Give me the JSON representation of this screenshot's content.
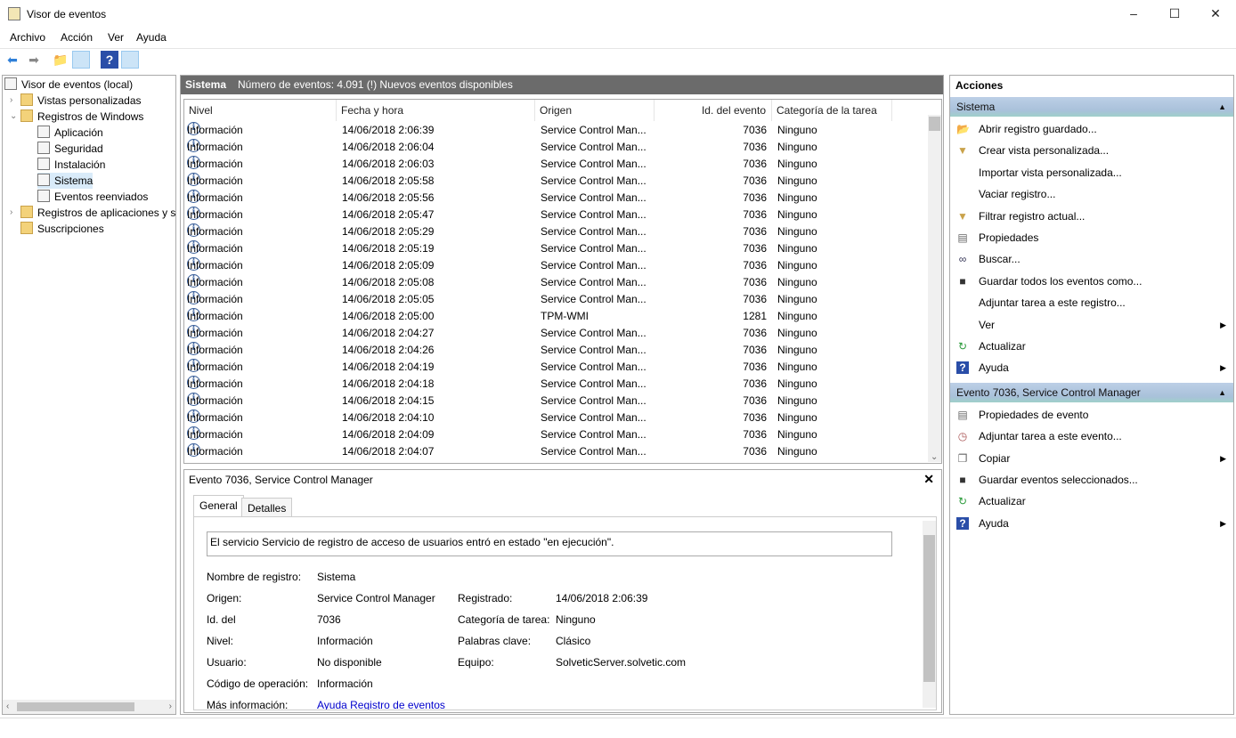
{
  "window": {
    "title": "Visor de eventos",
    "min": "–",
    "max": "☐",
    "close": "✕"
  },
  "menu": [
    "Archivo",
    "Acción",
    "Ver",
    "Ayuda"
  ],
  "tree": [
    {
      "label": "Visor de eventos (local)",
      "level": 0,
      "exp": ""
    },
    {
      "label": "Vistas personalizadas",
      "level": 1,
      "exp": "›"
    },
    {
      "label": "Registros de Windows",
      "level": 1,
      "exp": "⌄"
    },
    {
      "label": "Aplicación",
      "level": 2,
      "exp": ""
    },
    {
      "label": "Seguridad",
      "level": 2,
      "exp": ""
    },
    {
      "label": "Instalación",
      "level": 2,
      "exp": ""
    },
    {
      "label": "Sistema",
      "level": 2,
      "exp": "",
      "selected": true
    },
    {
      "label": "Eventos reenviados",
      "level": 2,
      "exp": ""
    },
    {
      "label": "Registros de aplicaciones y s",
      "level": 1,
      "exp": "›"
    },
    {
      "label": "Suscripciones",
      "level": 1,
      "exp": ""
    }
  ],
  "center": {
    "title": "Sistema",
    "summary": "Número de eventos: 4.091 (!) Nuevos eventos disponibles"
  },
  "columns": [
    "Nivel",
    "Fecha y hora",
    "Origen",
    "Id. del evento",
    "Categoría de la tarea"
  ],
  "rows": [
    [
      "Información",
      "14/06/2018 2:06:39",
      "Service Control Man...",
      "7036",
      "Ninguno"
    ],
    [
      "Información",
      "14/06/2018 2:06:04",
      "Service Control Man...",
      "7036",
      "Ninguno"
    ],
    [
      "Información",
      "14/06/2018 2:06:03",
      "Service Control Man...",
      "7036",
      "Ninguno"
    ],
    [
      "Información",
      "14/06/2018 2:05:58",
      "Service Control Man...",
      "7036",
      "Ninguno"
    ],
    [
      "Información",
      "14/06/2018 2:05:56",
      "Service Control Man...",
      "7036",
      "Ninguno"
    ],
    [
      "Información",
      "14/06/2018 2:05:47",
      "Service Control Man...",
      "7036",
      "Ninguno"
    ],
    [
      "Información",
      "14/06/2018 2:05:29",
      "Service Control Man...",
      "7036",
      "Ninguno"
    ],
    [
      "Información",
      "14/06/2018 2:05:19",
      "Service Control Man...",
      "7036",
      "Ninguno"
    ],
    [
      "Información",
      "14/06/2018 2:05:09",
      "Service Control Man...",
      "7036",
      "Ninguno"
    ],
    [
      "Información",
      "14/06/2018 2:05:08",
      "Service Control Man...",
      "7036",
      "Ninguno"
    ],
    [
      "Información",
      "14/06/2018 2:05:05",
      "Service Control Man...",
      "7036",
      "Ninguno"
    ],
    [
      "Información",
      "14/06/2018 2:05:00",
      "TPM-WMI",
      "1281",
      "Ninguno"
    ],
    [
      "Información",
      "14/06/2018 2:04:27",
      "Service Control Man...",
      "7036",
      "Ninguno"
    ],
    [
      "Información",
      "14/06/2018 2:04:26",
      "Service Control Man...",
      "7036",
      "Ninguno"
    ],
    [
      "Información",
      "14/06/2018 2:04:19",
      "Service Control Man...",
      "7036",
      "Ninguno"
    ],
    [
      "Información",
      "14/06/2018 2:04:18",
      "Service Control Man...",
      "7036",
      "Ninguno"
    ],
    [
      "Información",
      "14/06/2018 2:04:15",
      "Service Control Man...",
      "7036",
      "Ninguno"
    ],
    [
      "Información",
      "14/06/2018 2:04:10",
      "Service Control Man...",
      "7036",
      "Ninguno"
    ],
    [
      "Información",
      "14/06/2018 2:04:09",
      "Service Control Man...",
      "7036",
      "Ninguno"
    ],
    [
      "Información",
      "14/06/2018 2:04:07",
      "Service Control Man...",
      "7036",
      "Ninguno"
    ]
  ],
  "detail": {
    "title": "Evento 7036, Service Control Manager",
    "tabs": [
      "General",
      "Detalles"
    ],
    "message": "El servicio Servicio de registro de acceso de usuarios entró en estado \"en ejecución\".",
    "left": [
      [
        "Nombre de registro:",
        "Sistema"
      ],
      [
        "Origen:",
        "Service Control Manager"
      ],
      [
        "Id. del",
        "7036"
      ],
      [
        "Nivel:",
        "Información"
      ],
      [
        "Usuario:",
        "No disponible"
      ],
      [
        "Código de operación:",
        "Información"
      ],
      [
        "Más información:",
        "Ayuda Registro de eventos"
      ]
    ],
    "right": [
      [
        "Registrado:",
        "14/06/2018 2:06:39"
      ],
      [
        "Categoría de tarea:",
        "Ninguno"
      ],
      [
        "Palabras clave:",
        "Clásico"
      ],
      [
        "Equipo:",
        "SolveticServer.solvetic.com"
      ]
    ]
  },
  "actions": {
    "title": "Acciones",
    "sections": [
      {
        "title": "Sistema",
        "items": [
          {
            "label": "Abrir registro guardado...",
            "icon": "folder-open-icon"
          },
          {
            "label": "Crear vista personalizada...",
            "icon": "filter-icon"
          },
          {
            "label": "Importar vista personalizada...",
            "icon": ""
          },
          {
            "label": "Vaciar registro...",
            "icon": ""
          },
          {
            "label": "Filtrar registro actual...",
            "icon": "filter-icon"
          },
          {
            "label": "Propiedades",
            "icon": "properties-icon"
          },
          {
            "label": "Buscar...",
            "icon": "binoculars-icon"
          },
          {
            "label": "Guardar todos los eventos como...",
            "icon": "save-icon"
          },
          {
            "label": "Adjuntar tarea a este registro...",
            "icon": ""
          },
          {
            "label": "Ver",
            "icon": "",
            "submenu": true
          },
          {
            "label": "Actualizar",
            "icon": "refresh-icon"
          },
          {
            "label": "Ayuda",
            "icon": "help-icon",
            "submenu": true
          }
        ]
      },
      {
        "title": "Evento 7036, Service Control Manager",
        "items": [
          {
            "label": "Propiedades de evento",
            "icon": "properties-icon"
          },
          {
            "label": "Adjuntar tarea a este evento...",
            "icon": "task-icon"
          },
          {
            "label": "Copiar",
            "icon": "copy-icon",
            "submenu": true
          },
          {
            "label": "Guardar eventos seleccionados...",
            "icon": "save-icon"
          },
          {
            "label": "Actualizar",
            "icon": "refresh-icon"
          },
          {
            "label": "Ayuda",
            "icon": "help-icon",
            "submenu": true
          }
        ]
      }
    ]
  },
  "colors": {
    "header_bar": "#6b6b6b",
    "section_bg": "#bccfe6",
    "selection": "#d9ebf9",
    "info_icon": "#3a5f9a"
  }
}
